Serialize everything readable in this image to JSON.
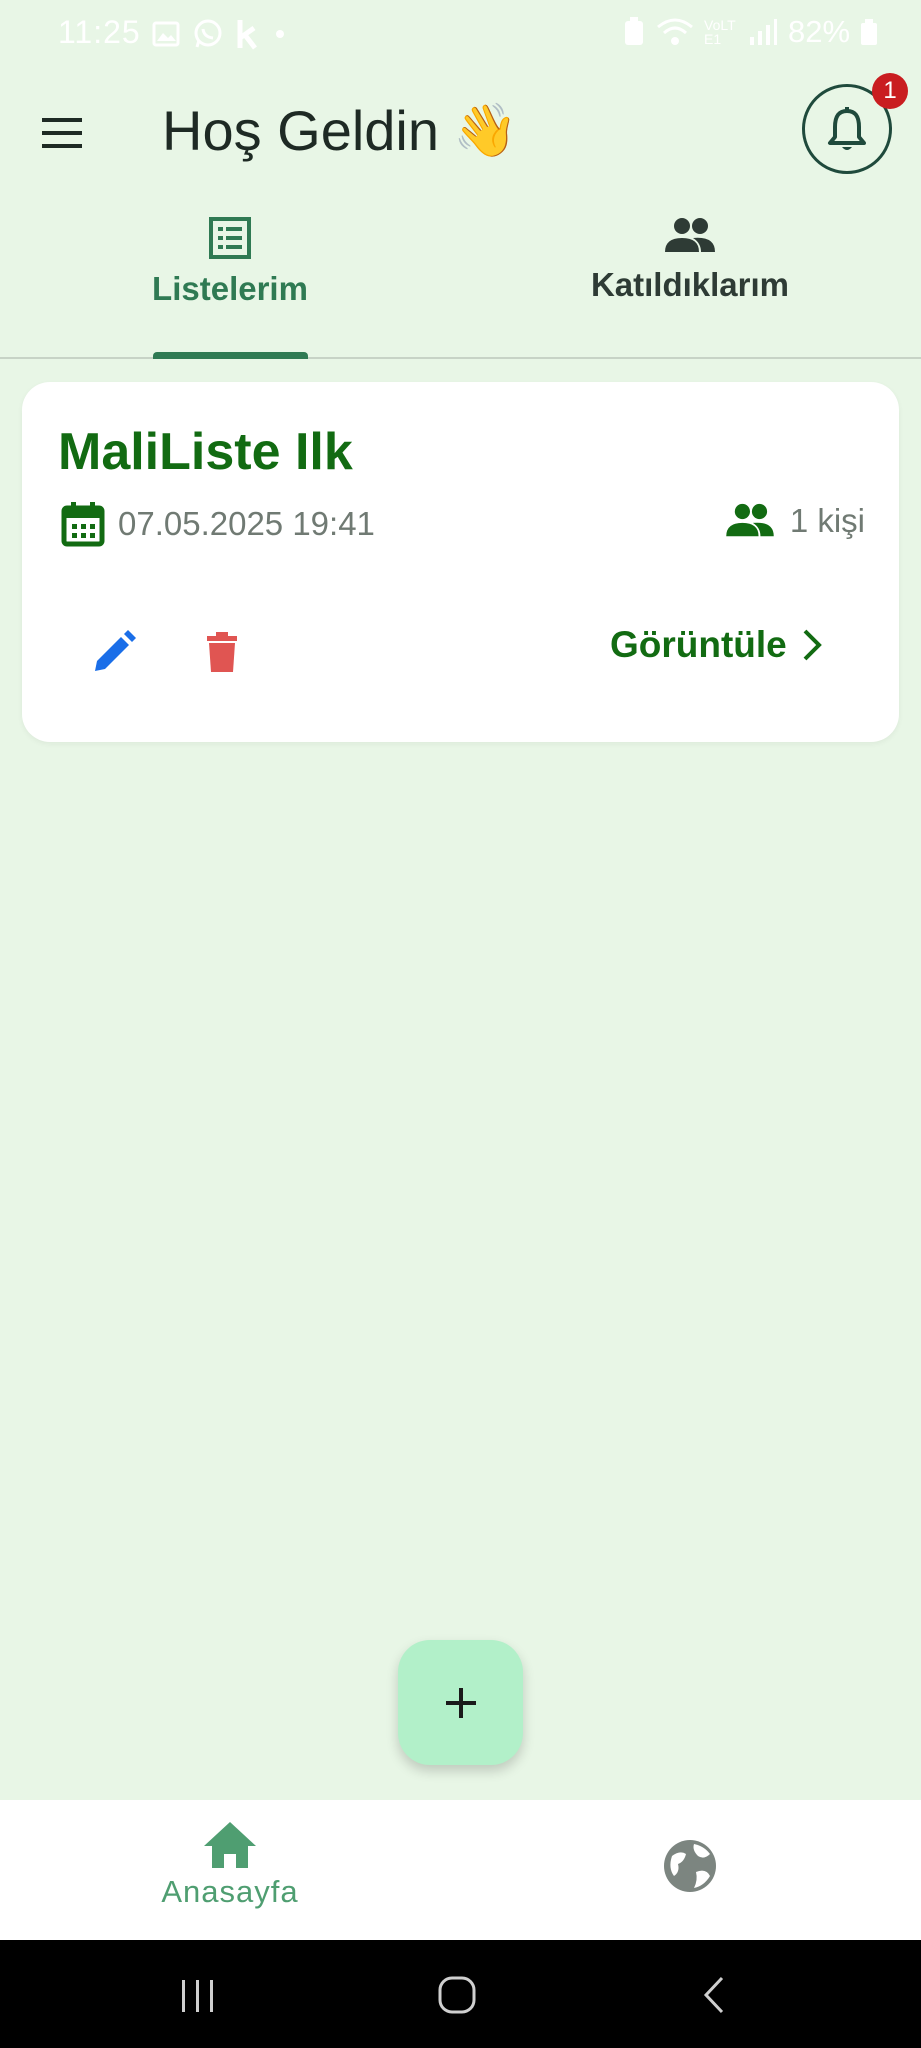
{
  "status_bar": {
    "time": "11:25",
    "battery": "82%",
    "network": "VoLTE1"
  },
  "header": {
    "title": "Hoş Geldin",
    "title_emoji": "👋",
    "notification_count": "1"
  },
  "tabs": [
    {
      "label": "Listelerim",
      "icon": "list-icon",
      "active": true
    },
    {
      "label": "Katıldıklarım",
      "icon": "group-icon",
      "active": false
    }
  ],
  "card": {
    "title": "MaliListe Ilk",
    "date": "07.05.2025 19:41",
    "people": "1 kişi",
    "view_label": "Görüntüle"
  },
  "fab": {
    "icon": "plus-icon"
  },
  "bottom_nav": {
    "home_label": "Anasayfa"
  },
  "colors": {
    "background": "#e8f6e6",
    "primary_green": "#126b12",
    "tab_active": "#2f7a53",
    "edit_blue": "#1a6ee8",
    "delete_red": "#e05552",
    "fab": "#b2f0c9",
    "badge": "#c91d20"
  }
}
